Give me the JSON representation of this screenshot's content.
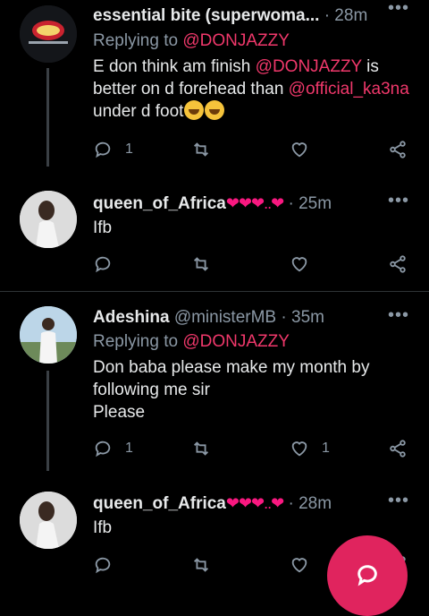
{
  "tweets": [
    {
      "name": "essential bite (superwoma...",
      "time": "· 28m",
      "replying_prefix": "Replying to ",
      "replying_to": "@DONJAZZY",
      "body_parts": [
        "E don think am finish ",
        "@DONJAZZY",
        " is better on d forehead than ",
        "@official_ka3na",
        " under d foot"
      ],
      "reply_count": "1",
      "retweet_count": "",
      "like_count": ""
    },
    {
      "name": "queen_of_Africa",
      "hearts": "❤❤❤..❤",
      "time": "· 25m",
      "body": "Ifb",
      "reply_count": "",
      "retweet_count": "",
      "like_count": ""
    },
    {
      "name": "Adeshina",
      "handle": "@ministerMB",
      "time": "· 35m",
      "replying_prefix": "Replying to ",
      "replying_to": "@DONJAZZY",
      "body_lines": [
        "Don baba please make my month by",
        "following me sir",
        "Please"
      ],
      "reply_count": "1",
      "retweet_count": "",
      "like_count": "1"
    },
    {
      "name": "queen_of_Africa",
      "hearts": "❤❤❤..❤",
      "time": "· 28m",
      "body": "Ifb",
      "reply_count": "",
      "retweet_count": "",
      "like_count": ""
    }
  ],
  "more_icon": "•••",
  "colors": {
    "background": "#000000",
    "mention": "#f0386b",
    "fab": "#e0245e",
    "muted": "#8b98a5"
  }
}
